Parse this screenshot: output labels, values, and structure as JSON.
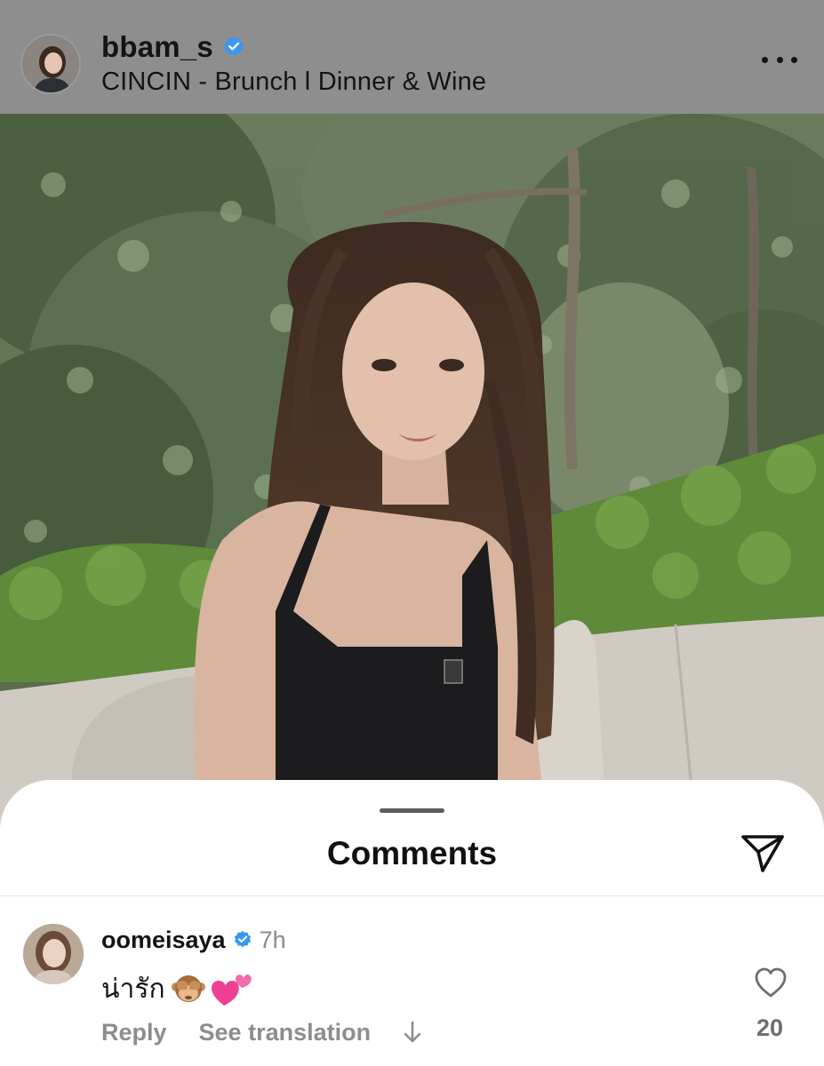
{
  "post": {
    "username": "bbam_s",
    "location": "CINCIN - Brunch l Dinner & Wine",
    "verified": true,
    "more_icon": "more-horizontal-icon"
  },
  "image": {
    "description_icon": "photo",
    "colors": {
      "foliage_dark": "#3f5236",
      "foliage_light": "#8aa07a",
      "sofa": "#cfcbc3",
      "dress": "#1c1c1e",
      "hair": "#4a3428",
      "skin": "#d9b5a0"
    }
  },
  "sheet": {
    "title": "Comments",
    "share_icon": "paper-plane-icon"
  },
  "comment": {
    "username": "oomeisaya",
    "verified": true,
    "time": "7h",
    "text": "น่ารัก",
    "emojis": [
      "see-no-evil-monkey",
      "two-hearts"
    ],
    "reply_label": "Reply",
    "translate_label": "See translation",
    "like_icon": "heart-outline-icon",
    "like_count": "20"
  },
  "colors": {
    "header_bg": "#8e8e8e",
    "verified_blue": "#3897f0",
    "text_primary": "#141414",
    "text_secondary": "#8d8d8d",
    "sheet_bg": "#ffffff"
  }
}
